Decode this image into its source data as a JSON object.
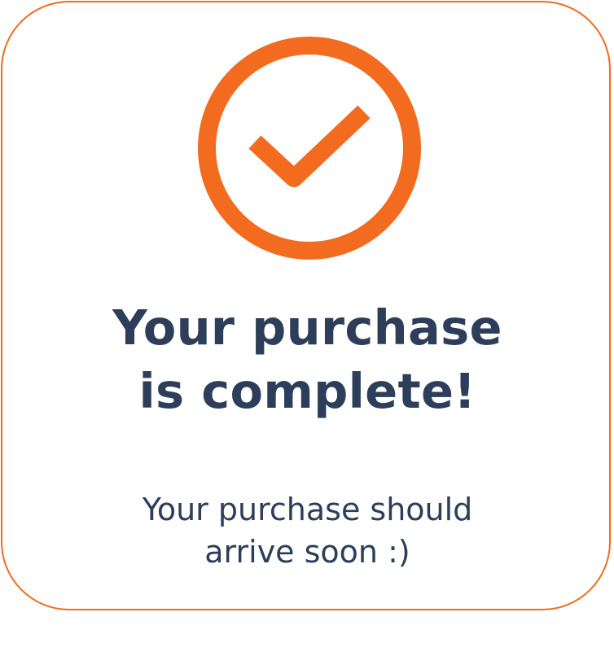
{
  "confirmation": {
    "icon": "check-circle-icon",
    "accent_color": "#f26b1f",
    "text_color": "#2c3e5a",
    "title_lines": [
      "Your purchase",
      "is complete!"
    ],
    "message_lines": [
      "Your purchase should",
      "arrive soon :)"
    ]
  }
}
